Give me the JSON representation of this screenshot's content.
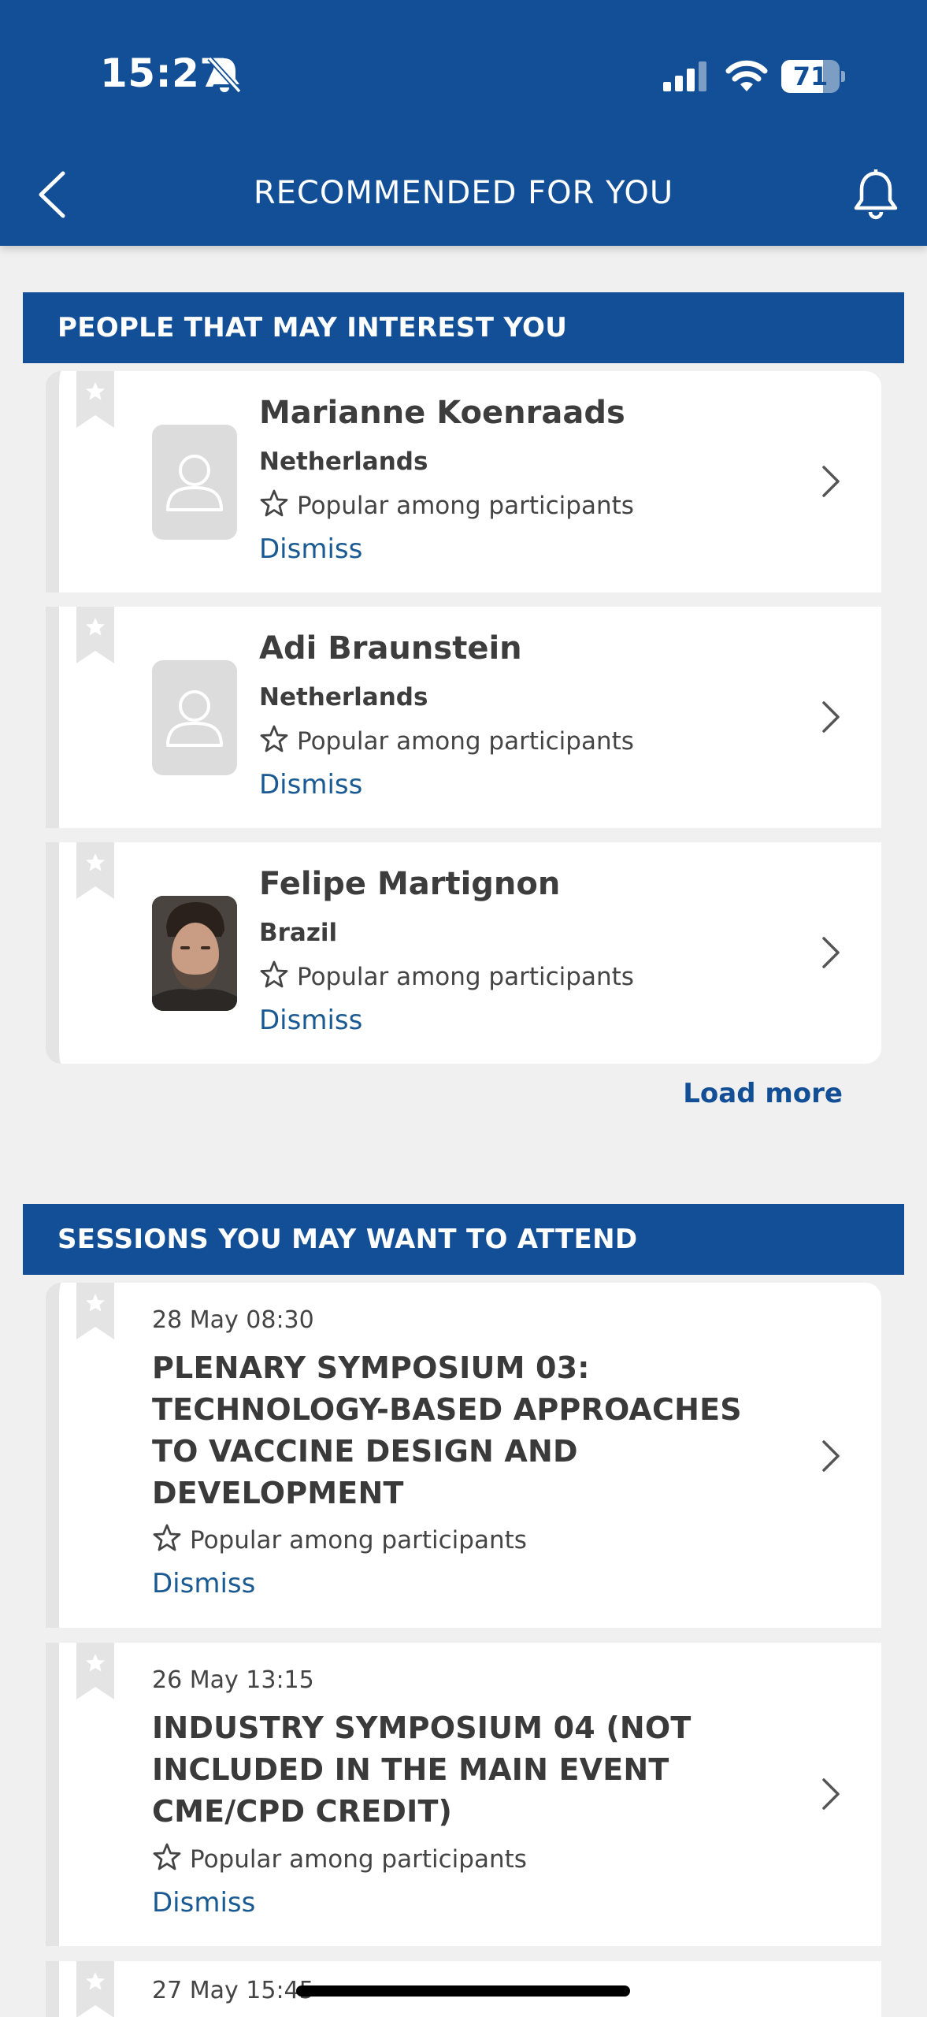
{
  "status_bar": {
    "time": "15:27",
    "battery_level": "71",
    "battery_fraction": 0.71
  },
  "nav": {
    "title": "RECOMMENDED FOR YOU",
    "back_icon": "chevron-left-icon",
    "right_icon": "bell-icon"
  },
  "colors": {
    "brand_blue": "#124f96",
    "link_blue": "#1a5a93",
    "background": "#f0f0f1"
  },
  "people_section": {
    "title": "PEOPLE THAT MAY INTEREST YOU",
    "people": [
      {
        "name": "Marianne Koenraads",
        "country": "Netherlands",
        "reason": "Popular among participants",
        "dismiss": "Dismiss",
        "avatar": "placeholder"
      },
      {
        "name": "Adi Braunstein",
        "country": "Netherlands",
        "reason": "Popular among participants",
        "dismiss": "Dismiss",
        "avatar": "placeholder"
      },
      {
        "name": "Felipe Martignon",
        "country": "Brazil",
        "reason": "Popular among participants",
        "dismiss": "Dismiss",
        "avatar": "photo"
      }
    ],
    "load_more": "Load more"
  },
  "sessions_section": {
    "title": "SESSIONS YOU MAY WANT TO ATTEND",
    "sessions": [
      {
        "date": "28 May  08:30",
        "title_lines": [
          "PLENARY SYMPOSIUM 03:",
          "TECHNOLOGY-BASED APPROACHES",
          "TO VACCINE DESIGN AND",
          "DEVELOPMENT"
        ],
        "reason": "Popular among participants",
        "dismiss": "Dismiss"
      },
      {
        "date": "26 May  13:15",
        "title_lines": [
          "INDUSTRY SYMPOSIUM 04 (NOT",
          "INCLUDED IN THE MAIN EVENT",
          "CME/CPD CREDIT)"
        ],
        "reason": "Popular among participants",
        "dismiss": "Dismiss"
      },
      {
        "date": "27 May  15:45"
      }
    ]
  }
}
